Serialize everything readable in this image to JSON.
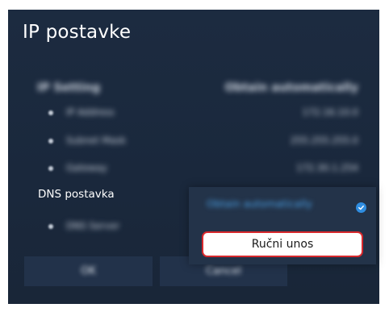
{
  "dialog": {
    "title": "IP postavke"
  },
  "settings": {
    "ip_setting": {
      "label": "IP Setting",
      "value": "Obtain automatically"
    },
    "ip_address": {
      "label": "IP Address",
      "value": "172.16.10.0"
    },
    "subnet_mask": {
      "label": "Subnet Mask",
      "value": "255.255.255.0"
    },
    "gateway": {
      "label": "Gateway",
      "value": "172.30.1.254"
    },
    "dns_setting": {
      "label": "DNS postavka"
    },
    "dns_server": {
      "label": "DNS Server"
    }
  },
  "dns_dropdown": {
    "options": [
      {
        "label": "Obtain automatically",
        "selected": true,
        "blurred": true
      },
      {
        "label": "Ručni unos",
        "selected": false,
        "focused": true
      }
    ],
    "check_icon": "check-circle-icon"
  },
  "buttons": {
    "ok_label": "OK",
    "cancel_label": "Cancel"
  },
  "colors": {
    "panel_bg": "#1c2b40",
    "accent_blue": "#2f8de0",
    "focus_border": "#d8282c"
  }
}
